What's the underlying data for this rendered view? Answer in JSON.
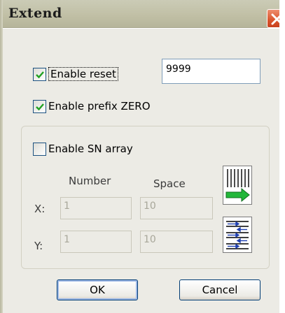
{
  "dialog": {
    "title": "Extend"
  },
  "options": {
    "enable_reset_label": "Enable reset",
    "enable_reset_checked": true,
    "reset_value": "9999",
    "enable_prefix_zero_label": "Enable prefix ZERO",
    "enable_prefix_zero_checked": true
  },
  "sn_array": {
    "enable_label": "Enable SN array",
    "enable_checked": false,
    "number_header": "Number",
    "space_header": "Space",
    "x_label": "X:",
    "y_label": "Y:",
    "x_number": "1",
    "x_space": "10",
    "y_number": "1",
    "y_space": "10"
  },
  "buttons": {
    "ok_label": "OK",
    "cancel_label": "Cancel"
  },
  "icons": {
    "close": "close-icon",
    "column_order": "column-order-arrow-icon",
    "row_order": "row-order-arrows-icon"
  },
  "colors": {
    "title_bar": "#c2c1a7",
    "close_button": "#d9542c",
    "dialog_body": "#ecebe5",
    "check_mark": "#21a121",
    "arrow_green": "#22b73a"
  }
}
